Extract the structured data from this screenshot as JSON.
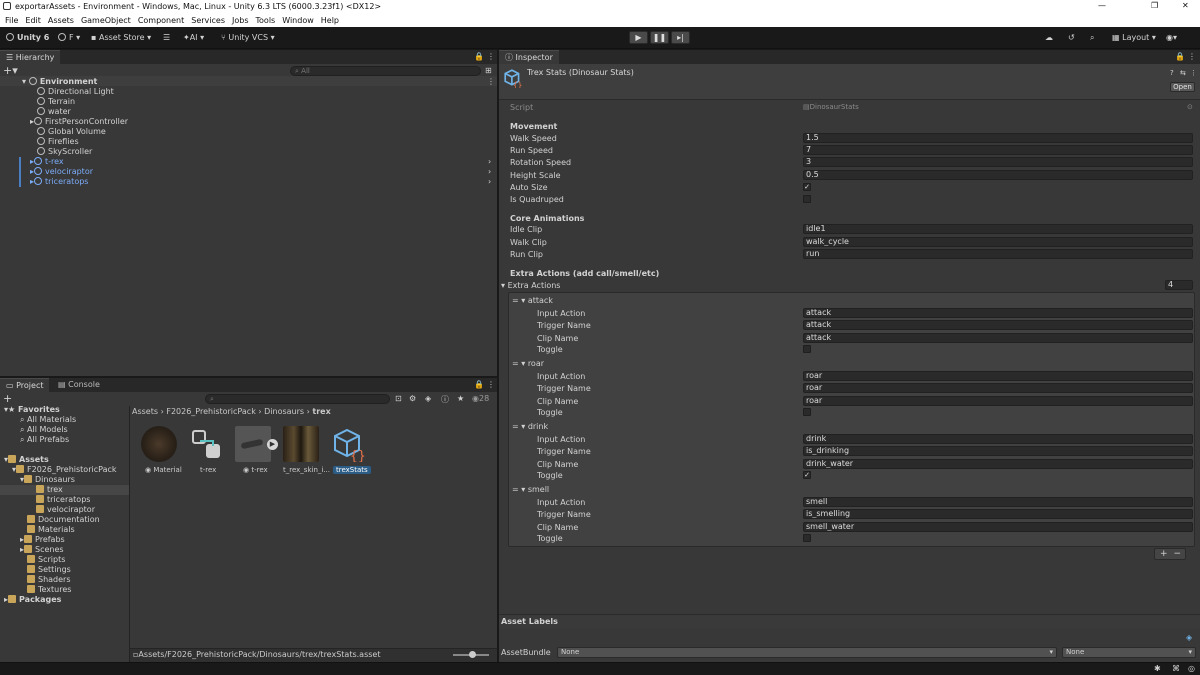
{
  "window": {
    "title": "exportarAssets - Environment - Windows, Mac, Linux - Unity 6.3 LTS (6000.3.23f1) <DX12>",
    "controls": [
      "—",
      "❐",
      "✕"
    ]
  },
  "menu": [
    "File",
    "Edit",
    "Assets",
    "GameObject",
    "Component",
    "Services",
    "Jobs",
    "Tools",
    "Window",
    "Help"
  ],
  "toolbar": {
    "account": "Unity 6",
    "user": "F ▾",
    "asset_store": "Asset Store ▾",
    "ai": "AI ▾",
    "vcs": "Unity VCS ▾",
    "layout": "Layout ▾"
  },
  "hierarchy": {
    "tab": "Hierarchy",
    "search_placeholder": "All",
    "scene": "Environment",
    "items": [
      {
        "label": "Directional Light"
      },
      {
        "label": "Terrain"
      },
      {
        "label": "water"
      },
      {
        "label": "FirstPersonController"
      },
      {
        "label": "Global Volume"
      },
      {
        "label": "Fireflies"
      },
      {
        "label": "SkyScroller"
      },
      {
        "label": "t-rex"
      },
      {
        "label": "velociraptor"
      },
      {
        "label": "triceratops"
      }
    ]
  },
  "project": {
    "tab_project": "Project",
    "tab_console": "Console",
    "hidden_count": "28",
    "favorites": {
      "label": "Favorites",
      "items": [
        "All Materials",
        "All Models",
        "All Prefabs"
      ]
    },
    "assets_root": "Assets",
    "tree": [
      "F2026_PrehistoricPack",
      "Dinosaurs",
      "trex",
      "triceratops",
      "velociraptor",
      "Documentation",
      "Materials",
      "Prefabs",
      "Scenes",
      "Scripts",
      "Settings",
      "Shaders",
      "Textures"
    ],
    "packages": "Packages",
    "breadcrumb": [
      "Assets",
      "F2026_PrehistoricPack",
      "Dinosaurs",
      "trex"
    ],
    "assets": [
      {
        "name": "Material"
      },
      {
        "name": "t-rex"
      },
      {
        "name": "t-rex"
      },
      {
        "name": "t_rex_skin_i..."
      },
      {
        "name": "trexStats"
      }
    ],
    "path": "Assets/F2026_PrehistoricPack/Dinosaurs/trex/trexStats.asset"
  },
  "inspector": {
    "tab": "Inspector",
    "title": "Trex Stats (Dinosaur Stats)",
    "open_button": "Open",
    "script_label": "Script",
    "script_value": "DinosaurStats",
    "movement_header": "Movement",
    "walk_speed": {
      "label": "Walk Speed",
      "value": "1.5"
    },
    "run_speed": {
      "label": "Run Speed",
      "value": "7"
    },
    "rotation_speed": {
      "label": "Rotation Speed",
      "value": "3"
    },
    "height_scale": {
      "label": "Height Scale",
      "value": "0.5"
    },
    "auto_size": {
      "label": "Auto Size",
      "checked": true
    },
    "is_quadruped": {
      "label": "Is Quadruped",
      "checked": false
    },
    "core_header": "Core Animations",
    "idle_clip": {
      "label": "Idle Clip",
      "value": "idle1"
    },
    "walk_clip": {
      "label": "Walk Clip",
      "value": "walk_cycle"
    },
    "run_clip": {
      "label": "Run Clip",
      "value": "run"
    },
    "extra_header": "Extra Actions (add call/smell/etc)",
    "extra_label": "Extra Actions",
    "extra_count": "4",
    "field_labels": {
      "input": "Input Action",
      "trigger": "Trigger Name",
      "clip": "Clip Name",
      "toggle": "Toggle"
    },
    "actions": [
      {
        "name": "attack",
        "input": "attack",
        "trigger": "attack",
        "clip": "attack",
        "toggle": false
      },
      {
        "name": "roar",
        "input": "roar",
        "trigger": "roar",
        "clip": "roar",
        "toggle": false
      },
      {
        "name": "drink",
        "input": "drink",
        "trigger": "is_drinking",
        "clip": "drink_water",
        "toggle": true
      },
      {
        "name": "smell",
        "input": "smell",
        "trigger": "is_smelling",
        "clip": "smell_water",
        "toggle": false
      }
    ],
    "plus": "+",
    "minus": "−",
    "asset_labels": "Asset Labels",
    "assetbundle_label": "AssetBundle",
    "assetbundle_value": "None",
    "variant_value": "None"
  },
  "colors": {
    "selection": "#2c5d87",
    "prefab_blue": "#7cacf8",
    "panel": "#383838",
    "field": "#2a2a2a"
  }
}
